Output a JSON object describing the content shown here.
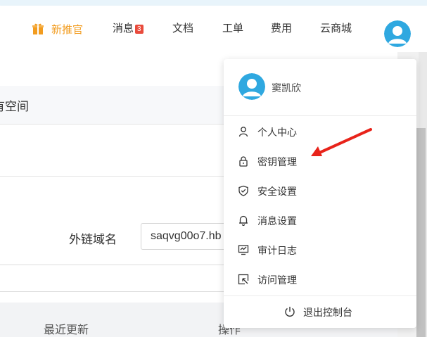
{
  "header": {
    "promo_label": "新推官",
    "messages_label": "消息",
    "messages_count": "3",
    "docs_label": "文档",
    "ticket_label": "工单",
    "fee_label": "费用",
    "market_label": "云商城"
  },
  "main": {
    "section_title": "有空间",
    "field_label": "外链域名",
    "field_value": "saqvg00o7.hb",
    "table_headers": [
      "最近更新",
      "操作"
    ]
  },
  "user_menu": {
    "username": "窦凯欣",
    "items": [
      {
        "label": "个人中心",
        "icon": "user-icon"
      },
      {
        "label": "密钥管理",
        "icon": "lock-icon"
      },
      {
        "label": "安全设置",
        "icon": "shield-icon"
      },
      {
        "label": "消息设置",
        "icon": "bell-icon"
      },
      {
        "label": "审计日志",
        "icon": "audit-log-icon"
      },
      {
        "label": "访问管理",
        "icon": "access-icon"
      }
    ],
    "logout_label": "退出控制台"
  },
  "colors": {
    "accent": "#f29c1f",
    "avatar_bg": "#2fa8e0",
    "badge": "#e94b3c",
    "arrow": "#e8231a"
  }
}
